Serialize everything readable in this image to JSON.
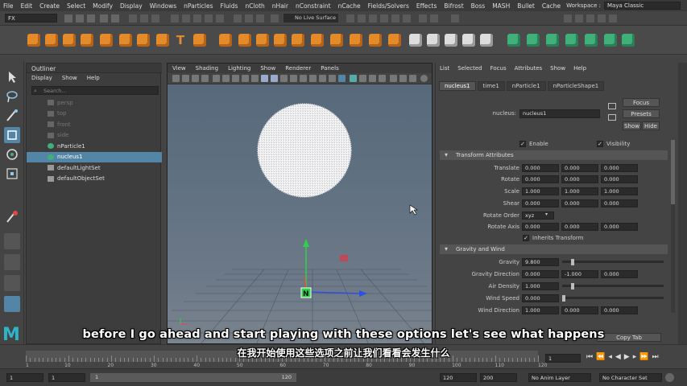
{
  "menubar": {
    "items": [
      "File",
      "Edit",
      "Create",
      "Select",
      "Modify",
      "Display",
      "Windows",
      "nParticles",
      "Fluids",
      "nCloth",
      "nHair",
      "nConstraint",
      "nCache",
      "Fields/Solvers",
      "Effects",
      "Bifrost",
      "Boss",
      "MASH",
      "Bullet",
      "Cache"
    ],
    "workspace_label": "Workspace :",
    "workspace_value": "Maya Classic"
  },
  "statusline": {
    "mode": "FX",
    "live_surface": "No Live Surface"
  },
  "outliner": {
    "tab": "Outliner",
    "menu": [
      "Display",
      "Show",
      "Help"
    ],
    "search_placeholder": "Search...",
    "items": [
      {
        "label": "persp",
        "dim": true
      },
      {
        "label": "top",
        "dim": true
      },
      {
        "label": "front",
        "dim": true
      },
      {
        "label": "side",
        "dim": true
      },
      {
        "label": "nParticle1",
        "dim": false
      },
      {
        "label": "nucleus1",
        "dim": false,
        "selected": true
      },
      {
        "label": "defaultLightSet",
        "dim": false
      },
      {
        "label": "defaultObjectSet",
        "dim": false
      }
    ]
  },
  "viewport": {
    "menu": [
      "View",
      "Shading",
      "Lighting",
      "Show",
      "Renderer",
      "Panels"
    ]
  },
  "attribute_editor": {
    "menu": [
      "List",
      "Selected",
      "Focus",
      "Attributes",
      "Show",
      "Help"
    ],
    "tabs": [
      "nucleus1",
      "time1",
      "nParticle1",
      "nParticleShape1"
    ],
    "node_label": "nucleus:",
    "node_value": "nucleus1",
    "focus_btn": "Focus",
    "presets_btn": "Presets",
    "show_btn": "Show",
    "hide_btn": "Hide",
    "enable_label": "Enable",
    "visibility_label": "Visibility",
    "transform_section": "Transform Attributes",
    "translate_label": "Translate",
    "translate": [
      "0.000",
      "0.000",
      "0.000"
    ],
    "rotate_label": "Rotate",
    "rotate": [
      "0.000",
      "0.000",
      "0.000"
    ],
    "scale_label": "Scale",
    "scale": [
      "1.000",
      "1.000",
      "1.000"
    ],
    "shear_label": "Shear",
    "shear": [
      "0.000",
      "0.000",
      "0.000"
    ],
    "rotate_order_label": "Rotate Order",
    "rotate_order": "xyz",
    "rotate_axis_label": "Rotate Axis",
    "rotate_axis": [
      "0.000",
      "0.000",
      "0.000"
    ],
    "inherits_label": "Inherits Transform",
    "gravity_section": "Gravity and Wind",
    "gravity_label": "Gravity",
    "gravity": "9.800",
    "gravity_dir_label": "Gravity Direction",
    "gravity_dir": [
      "0.000",
      "-1.000",
      "0.000"
    ],
    "air_density_label": "Air Density",
    "air_density": "1.000",
    "wind_speed_label": "Wind Speed",
    "wind_speed": "0.000",
    "wind_dir_label": "Wind Direction",
    "wind_dir": [
      "1.000",
      "0.000",
      "0.000"
    ],
    "copy_tab": "Copy Tab"
  },
  "timeline": {
    "ticks": [
      "1",
      "10",
      "20",
      "30",
      "40",
      "50",
      "60",
      "70",
      "80",
      "90",
      "100",
      "110",
      "120"
    ],
    "current_frame": "1"
  },
  "rangebar": {
    "start": "1",
    "anim_start": "1",
    "range_start_marker": "1",
    "range_end_marker": "120",
    "anim_end": "120",
    "end": "200",
    "anim_layer": "No Anim Layer",
    "char_set": "No Character Set"
  },
  "subtitles": {
    "en": "before I go ahead and start playing with these options let's see what happens",
    "zh": "在我开始使用这些选项之前让我们看看会发生什么"
  },
  "logo": "M",
  "colors": {
    "selection": "#5285a6",
    "shelf_orange": "#e38a2b",
    "shelf_green": "#3fb07a",
    "maya_teal": "#2fb3c8"
  }
}
